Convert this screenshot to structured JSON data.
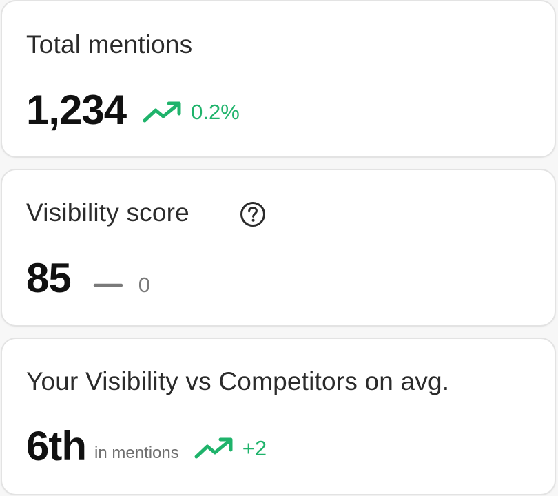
{
  "cards": {
    "mentions": {
      "title": "Total mentions",
      "value": "1,234",
      "trend": {
        "direction": "up",
        "icon": "trending-up-icon",
        "text": "0.2%"
      }
    },
    "visibility": {
      "title": "Visibility score",
      "help_icon": "question-circle-icon",
      "value": "85",
      "trend": {
        "direction": "flat",
        "icon": "dash-icon",
        "text": "0"
      }
    },
    "rank": {
      "title": "Your Visibility vs Competitors on avg.",
      "value": "6th",
      "sub_label": "in mentions",
      "trend": {
        "direction": "up",
        "icon": "trending-up-icon",
        "text": "+2"
      }
    }
  },
  "colors": {
    "positive": "#1fb36b",
    "neutral": "#7a7a7a",
    "text": "#111111",
    "card_border": "#e3e3e3"
  }
}
